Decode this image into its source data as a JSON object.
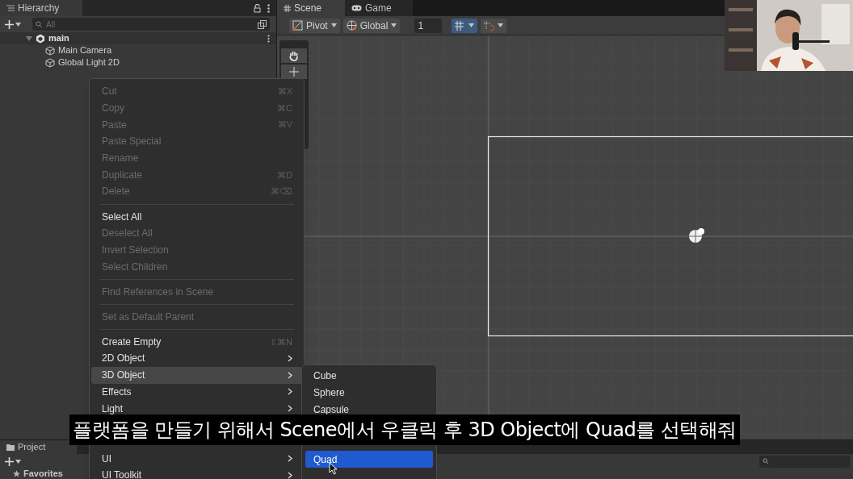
{
  "hierarchy": {
    "title": "Hierarchy",
    "search": {
      "placeholder": "All"
    },
    "tree": [
      {
        "label": "main",
        "kind": "scene",
        "expanded": true,
        "children": [
          {
            "label": "Main Camera",
            "kind": "object"
          },
          {
            "label": "Global Light 2D",
            "kind": "object"
          }
        ]
      }
    ]
  },
  "scene_tabs": [
    {
      "label": "Scene",
      "kind": "scene",
      "selected": true
    },
    {
      "label": "Game",
      "kind": "game",
      "selected": false
    }
  ],
  "toolbar": {
    "pivot": "Pivot",
    "space": "Global",
    "grid_size": "1"
  },
  "context_menu": {
    "sections": [
      [
        {
          "label": "Cut",
          "shortcut": "⌘X",
          "enabled": false
        },
        {
          "label": "Copy",
          "shortcut": "⌘C",
          "enabled": false
        },
        {
          "label": "Paste",
          "shortcut": "⌘V",
          "enabled": false
        },
        {
          "label": "Paste Special",
          "enabled": false
        },
        {
          "label": "Rename",
          "enabled": false
        },
        {
          "label": "Duplicate",
          "shortcut": "⌘D",
          "enabled": false
        },
        {
          "label": "Delete",
          "shortcut": "⌘⌫",
          "enabled": false
        }
      ],
      [
        {
          "label": "Select All",
          "enabled": true
        },
        {
          "label": "Deselect All",
          "enabled": false
        },
        {
          "label": "Invert Selection",
          "enabled": false
        },
        {
          "label": "Select Children",
          "enabled": false
        }
      ],
      [
        {
          "label": "Find References in Scene",
          "enabled": false
        }
      ],
      [
        {
          "label": "Set as Default Parent",
          "enabled": false
        }
      ],
      [
        {
          "label": "Create Empty",
          "shortcut": "⇧⌘N",
          "enabled": true
        },
        {
          "label": "2D Object",
          "submenu": true,
          "enabled": true
        },
        {
          "label": "3D Object",
          "submenu": true,
          "enabled": true,
          "selected": true
        },
        {
          "label": "Effects",
          "submenu": true,
          "enabled": true
        },
        {
          "label": "Light",
          "submenu": true,
          "enabled": true
        }
      ]
    ],
    "items_below": [
      {
        "label": "UI",
        "submenu": true,
        "enabled": true,
        "selected": false
      },
      {
        "label": "UI Toolkit",
        "submenu": true,
        "enabled": true,
        "selected": false
      }
    ]
  },
  "submenu": {
    "items_top": [
      {
        "label": "Cube",
        "selected": false
      },
      {
        "label": "Sphere",
        "selected": false
      },
      {
        "label": "Capsule",
        "selected": false
      }
    ],
    "items_below": [
      {
        "label": "Quad",
        "selected": true
      }
    ]
  },
  "project": {
    "title": "Project",
    "favorites": "Favorites"
  },
  "subtitle": "플랫폼을 만들기 위해서 Scene에서 우클릭 후 3D Object에 Quad를 선택해줘"
}
